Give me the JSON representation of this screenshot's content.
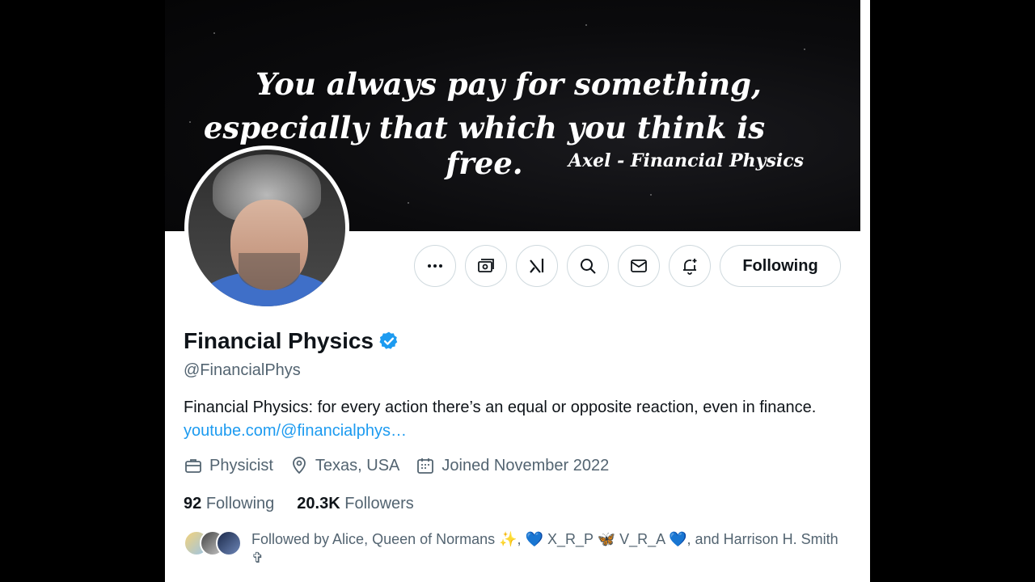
{
  "banner": {
    "quote_line1": "You always pay for something,",
    "quote_line2": "especially that which you think is free.",
    "attribution": "Axel - Financial Physics"
  },
  "actions": {
    "more_icon": "more-icon",
    "subscribe_icon": "money-icon",
    "grok_icon": "grok-icon",
    "search_icon": "search-icon",
    "message_icon": "mail-icon",
    "notify_icon": "bell-plus-icon",
    "following_label": "Following"
  },
  "profile": {
    "name": "Financial Physics",
    "handle": "@FinancialPhys",
    "bio_text": "Financial Physics: for every action there’s an equal or opposite reaction, even in finance. ",
    "bio_link": "youtube.com/@financialphys…",
    "profession": "Physicist",
    "location": "Texas, USA",
    "joined": "Joined November 2022",
    "following_count": "92",
    "following_label": "Following",
    "followers_count": "20.3K",
    "followers_label": "Followers",
    "followed_by": "Followed by Alice, Queen of Normans ✨, 💙 X_R_P 🦋 V_R_A 💙, and Harrison H. Smith ✞"
  },
  "colors": {
    "accent": "#1d9bf0",
    "verified": "#1d9bf0",
    "secondary_text": "#536471",
    "border": "#cfd9de"
  }
}
